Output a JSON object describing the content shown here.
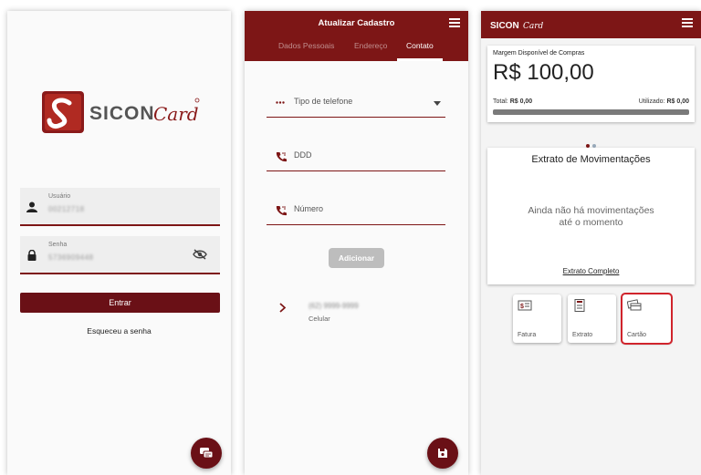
{
  "colors": {
    "accent": "#7d1616",
    "accent_dark": "#6a1016",
    "highlight": "#d0242c"
  },
  "login": {
    "brand_text": "SICONCard",
    "user_label": "Usuário",
    "user_value": "00212718",
    "pass_label": "Senha",
    "pass_value": "5736909448",
    "enter_button": "Entrar",
    "forgot_link": "Esqueceu a senha",
    "icons": {
      "user": "user-icon",
      "lock": "lock-icon",
      "eye": "eye-off-icon",
      "chat": "chat-icon"
    }
  },
  "cadastro": {
    "title": "Atualizar Cadastro",
    "tabs": [
      "Dados Pessoais",
      "Endereço",
      "Contato"
    ],
    "active_tab": "Contato",
    "phone_type_label": "Tipo de telefone",
    "ddd_label": "DDD",
    "number_label": "Número",
    "add_button": "Adicionar",
    "contact_number": "(62) 9999-9999",
    "contact_type": "Celular",
    "icons": {
      "menu": "menu-icon",
      "phone": "phone-icon",
      "chevron": "chevron-right-icon",
      "save": "save-icon"
    }
  },
  "home": {
    "brand_text": "SICONCard",
    "margin_title": "Margem Disponível de Compras",
    "margin_value": "R$ 100,00",
    "total_label": "Total:",
    "total_value": "R$ 0,00",
    "used_label": "Utilizado:",
    "used_value": "R$ 0,00",
    "used_fraction": 0,
    "extrato_title": "Extrato de Movimentações",
    "empty_line1": "Ainda não há movimentações",
    "empty_line2": "até o momento",
    "extrato_link": "Extrato Completo",
    "quick": [
      {
        "label": "Fatura",
        "icon": "invoice-icon"
      },
      {
        "label": "Extrato",
        "icon": "statement-icon"
      },
      {
        "label": "Cartão",
        "icon": "card-icon"
      }
    ]
  }
}
